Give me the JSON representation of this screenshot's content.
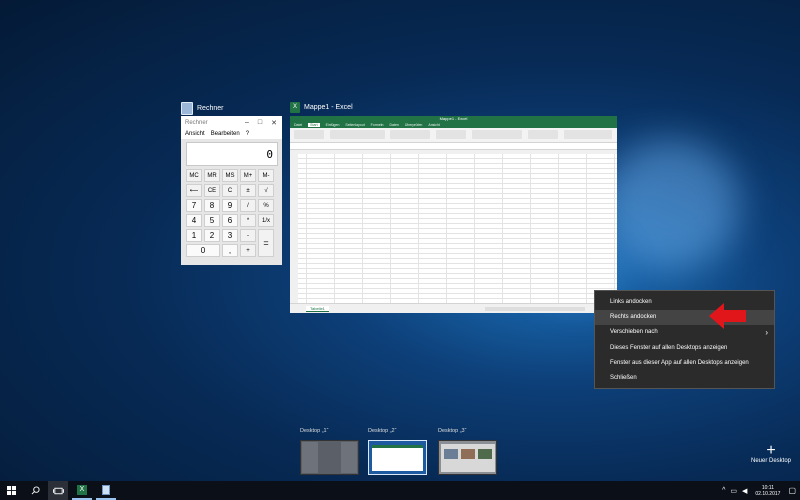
{
  "windows": {
    "calculator": {
      "label": "Rechner",
      "title": "Rechner",
      "menu": [
        "Ansicht",
        "Bearbeiten",
        "?"
      ],
      "display_value": "0",
      "keys": [
        [
          "MC",
          "MR",
          "MS",
          "M+",
          "M-"
        ],
        [
          "⟵",
          "CE",
          "C",
          "±",
          "√"
        ],
        [
          "7",
          "8",
          "9",
          "/",
          "%"
        ],
        [
          "4",
          "5",
          "6",
          "*",
          "1/x"
        ],
        [
          "1",
          "2",
          "3",
          "-",
          "="
        ],
        [
          "0",
          ",",
          "+"
        ]
      ]
    },
    "excel": {
      "label": "Mappe1 - Excel",
      "title": "Mappe1 - Excel",
      "ribbon_tabs": [
        "Datei",
        "Start",
        "Einfügen",
        "Seitenlayout",
        "Formeln",
        "Daten",
        "Überprüfen",
        "Ansicht"
      ],
      "sheet_tab": "Tabelle1"
    }
  },
  "context_menu": {
    "items": [
      {
        "label": "Links andocken"
      },
      {
        "label": "Rechts andocken"
      },
      {
        "label": "Verschieben nach"
      },
      {
        "label": "Dieses Fenster auf allen Desktops anzeigen"
      },
      {
        "label": "Fenster aus dieser App auf allen Desktops anzeigen"
      },
      {
        "label": "Schließen"
      }
    ],
    "highlighted_index": 1,
    "submenu_arrow": "›"
  },
  "desktops": [
    {
      "label": "Desktop „1“"
    },
    {
      "label": "Desktop „2“",
      "active": true
    },
    {
      "label": "Desktop „3“"
    }
  ],
  "new_desktop": {
    "icon": "+",
    "label": "Neuer Desktop"
  },
  "taskbar": {
    "icons": [
      "windows-start-icon",
      "search-icon",
      "task-view-icon",
      "excel-icon",
      "notepad-icon"
    ],
    "clock": {
      "time": "10:11",
      "date": "02.10.2017"
    },
    "tray_icons": [
      "chevron-up-icon",
      "network-icon",
      "volume-icon",
      "notification-icon"
    ]
  },
  "colors": {
    "excel_green": "#217346",
    "arrow_red": "#e0161b",
    "menu_bg": "#2b2b2b"
  }
}
